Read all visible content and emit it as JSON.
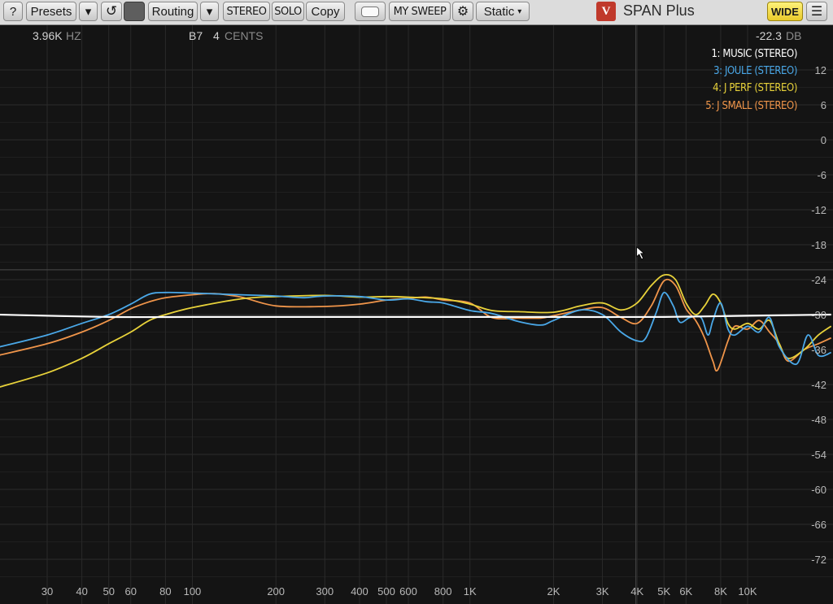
{
  "toolbar": {
    "help_label": "?",
    "presets_label": "Presets",
    "reset_glyph": "↺",
    "routing_label": "Routing",
    "stereo_label": "STEREO",
    "solo_label": "SOLO",
    "copy_label": "Copy",
    "sweep_label": "MY SWEEP",
    "gear_glyph": "⚙",
    "mode_label": "Static",
    "title": "SPAN Plus",
    "logo_text": "V",
    "wide_label": "WIDE",
    "menu_glyph": "☰",
    "caret_glyph": "▾"
  },
  "readout": {
    "frequency": "3.96K",
    "freq_unit": "HZ",
    "note": "B7",
    "cents": "4",
    "cents_unit": "CENTS",
    "level": "-22.3",
    "level_unit": "DB"
  },
  "chart_data": {
    "type": "line",
    "x_scale": "log",
    "x_range": [
      20,
      20000
    ],
    "y_range": [
      -76,
      16
    ],
    "grid": true,
    "x_ticks": [
      {
        "f": 30,
        "label": "30"
      },
      {
        "f": 40,
        "label": "40"
      },
      {
        "f": 50,
        "label": "50"
      },
      {
        "f": 60,
        "label": "60"
      },
      {
        "f": 80,
        "label": "80"
      },
      {
        "f": 100,
        "label": "100"
      },
      {
        "f": 200,
        "label": "200"
      },
      {
        "f": 300,
        "label": "300"
      },
      {
        "f": 400,
        "label": "400"
      },
      {
        "f": 500,
        "label": "500"
      },
      {
        "f": 600,
        "label": "600"
      },
      {
        "f": 800,
        "label": "800"
      },
      {
        "f": 1000,
        "label": "1K"
      },
      {
        "f": 2000,
        "label": "2K"
      },
      {
        "f": 3000,
        "label": "3K"
      },
      {
        "f": 4000,
        "label": "4K"
      },
      {
        "f": 5000,
        "label": "5K"
      },
      {
        "f": 6000,
        "label": "6K"
      },
      {
        "f": 8000,
        "label": "8K"
      },
      {
        "f": 10000,
        "label": "10K"
      }
    ],
    "y_ticks": [
      12,
      6,
      0,
      -6,
      -12,
      -18,
      -24,
      -30,
      -36,
      -42,
      -48,
      -54,
      -60,
      -66,
      -72
    ],
    "cursor": {
      "freq": 3960,
      "level": -22.3
    },
    "legend": [
      {
        "label": "1: MUSIC (STEREO)",
        "color": "#ffffff"
      },
      {
        "label": "3: JOULE (STEREO)",
        "color": "#4aa8e8"
      },
      {
        "label": "4: J PERF (STEREO)",
        "color": "#e8d23a"
      },
      {
        "label": "5: J SMALL (STEREO)",
        "color": "#f0954a"
      }
    ],
    "series": [
      {
        "color": "#ffffff",
        "points": [
          [
            20,
            -30.0
          ],
          [
            50,
            -30.4
          ],
          [
            100,
            -30.4
          ],
          [
            200,
            -30.4
          ],
          [
            500,
            -30.4
          ],
          [
            1000,
            -30.4
          ],
          [
            2000,
            -30.4
          ],
          [
            5000,
            -30.4
          ],
          [
            10000,
            -30.2
          ],
          [
            20000,
            -30.0
          ]
        ]
      },
      {
        "color": "#4aa8e8",
        "points": [
          [
            20,
            -35.6
          ],
          [
            30,
            -33.5
          ],
          [
            40,
            -31.5
          ],
          [
            50,
            -30.0
          ],
          [
            60,
            -28.2
          ],
          [
            70,
            -26.5
          ],
          [
            80,
            -26.2
          ],
          [
            100,
            -26.3
          ],
          [
            150,
            -26.6
          ],
          [
            200,
            -26.8
          ],
          [
            250,
            -27.1
          ],
          [
            300,
            -26.8
          ],
          [
            400,
            -26.9
          ],
          [
            500,
            -27.5
          ],
          [
            600,
            -27.3
          ],
          [
            700,
            -27.8
          ],
          [
            800,
            -28.0
          ],
          [
            1000,
            -29.3
          ],
          [
            1200,
            -29.8
          ],
          [
            1500,
            -31.2
          ],
          [
            1800,
            -31.8
          ],
          [
            2000,
            -31.0
          ],
          [
            2500,
            -29.2
          ],
          [
            3000,
            -30.0
          ],
          [
            3500,
            -33.0
          ],
          [
            4000,
            -34.5
          ],
          [
            4300,
            -34.0
          ],
          [
            4700,
            -29.5
          ],
          [
            5000,
            -26.2
          ],
          [
            5400,
            -28.5
          ],
          [
            5700,
            -31.3
          ],
          [
            6200,
            -30.5
          ],
          [
            6800,
            -30.5
          ],
          [
            7200,
            -33.5
          ],
          [
            7500,
            -31.0
          ],
          [
            8000,
            -28.0
          ],
          [
            8500,
            -32.5
          ],
          [
            9000,
            -33.5
          ],
          [
            10000,
            -32.0
          ],
          [
            11000,
            -33.0
          ],
          [
            12000,
            -30.5
          ],
          [
            13000,
            -35.5
          ],
          [
            15000,
            -38.5
          ],
          [
            16500,
            -33.5
          ],
          [
            18000,
            -37.0
          ],
          [
            20000,
            -36.5
          ]
        ]
      },
      {
        "color": "#e8d23a",
        "points": [
          [
            20,
            -42.5
          ],
          [
            30,
            -40.0
          ],
          [
            40,
            -37.5
          ],
          [
            50,
            -35.0
          ],
          [
            60,
            -33.0
          ],
          [
            70,
            -31.0
          ],
          [
            80,
            -30.0
          ],
          [
            100,
            -28.8
          ],
          [
            150,
            -27.3
          ],
          [
            200,
            -26.9
          ],
          [
            300,
            -26.7
          ],
          [
            400,
            -27.0
          ],
          [
            500,
            -26.9
          ],
          [
            600,
            -27.0
          ],
          [
            800,
            -27.3
          ],
          [
            1000,
            -28.2
          ],
          [
            1200,
            -29.3
          ],
          [
            1500,
            -29.5
          ],
          [
            2000,
            -29.6
          ],
          [
            2500,
            -28.5
          ],
          [
            3000,
            -28.0
          ],
          [
            3500,
            -29.2
          ],
          [
            4000,
            -28.0
          ],
          [
            4500,
            -25.0
          ],
          [
            5000,
            -23.2
          ],
          [
            5500,
            -24.0
          ],
          [
            6000,
            -28.0
          ],
          [
            6500,
            -30.0
          ],
          [
            7000,
            -28.5
          ],
          [
            7500,
            -26.5
          ],
          [
            8000,
            -28.0
          ],
          [
            8500,
            -31.5
          ],
          [
            9000,
            -32.5
          ],
          [
            10000,
            -31.5
          ],
          [
            11000,
            -32.5
          ],
          [
            12000,
            -31.0
          ],
          [
            13000,
            -35.0
          ],
          [
            14000,
            -37.5
          ],
          [
            16000,
            -36.0
          ],
          [
            18000,
            -33.5
          ],
          [
            20000,
            -32.0
          ]
        ]
      },
      {
        "color": "#f0954a",
        "points": [
          [
            20,
            -37.0
          ],
          [
            30,
            -35.0
          ],
          [
            40,
            -33.0
          ],
          [
            50,
            -31.0
          ],
          [
            60,
            -29.0
          ],
          [
            70,
            -27.8
          ],
          [
            80,
            -27.1
          ],
          [
            100,
            -26.6
          ],
          [
            120,
            -26.4
          ],
          [
            150,
            -27.0
          ],
          [
            200,
            -28.5
          ],
          [
            300,
            -28.6
          ],
          [
            400,
            -28.2
          ],
          [
            500,
            -27.5
          ],
          [
            600,
            -27.2
          ],
          [
            700,
            -27.0
          ],
          [
            800,
            -27.5
          ],
          [
            1000,
            -28.0
          ],
          [
            1200,
            -30.5
          ],
          [
            1500,
            -30.6
          ],
          [
            1800,
            -30.6
          ],
          [
            2000,
            -30.2
          ],
          [
            2500,
            -29.2
          ],
          [
            3000,
            -28.8
          ],
          [
            3500,
            -30.5
          ],
          [
            4000,
            -31.5
          ],
          [
            4500,
            -28.5
          ],
          [
            5000,
            -24.2
          ],
          [
            5500,
            -25.0
          ],
          [
            6000,
            -29.0
          ],
          [
            6500,
            -31.0
          ],
          [
            7000,
            -34.0
          ],
          [
            7500,
            -38.0
          ],
          [
            7800,
            -39.5
          ],
          [
            8500,
            -34.5
          ],
          [
            9000,
            -32.0
          ],
          [
            10000,
            -32.5
          ],
          [
            11000,
            -31.0
          ],
          [
            12000,
            -33.0
          ],
          [
            13000,
            -35.0
          ],
          [
            14000,
            -38.0
          ],
          [
            16000,
            -36.0
          ],
          [
            18000,
            -35.0
          ],
          [
            20000,
            -34.0
          ]
        ]
      }
    ]
  }
}
